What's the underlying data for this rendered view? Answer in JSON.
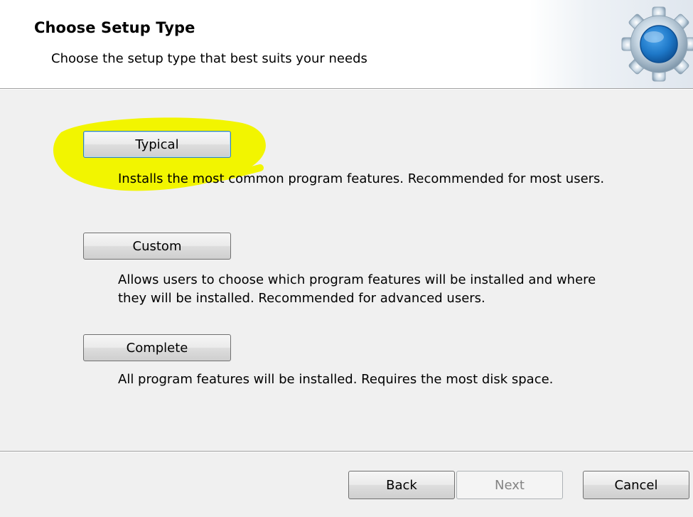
{
  "header": {
    "title": "Choose Setup Type",
    "subtitle": "Choose the setup type that best suits your needs",
    "icon": "gear-icon"
  },
  "options": [
    {
      "id": "typical",
      "label": "Typical",
      "description_lines": [
        "Installs the most common program features. Recommended for most users."
      ],
      "is_default": true
    },
    {
      "id": "custom",
      "label": "Custom",
      "description_lines": [
        "Allows users to choose which program features will be installed and where",
        "they will be installed. Recommended for advanced users."
      ],
      "is_default": false
    },
    {
      "id": "complete",
      "label": "Complete",
      "description_lines": [
        "All program features will be installed. Requires the most disk space."
      ],
      "is_default": false
    }
  ],
  "footer": {
    "back_label": "Back",
    "next_label": "Next",
    "next_enabled": false,
    "cancel_label": "Cancel"
  },
  "colors": {
    "highlight": "#f2f500",
    "dialog_background": "#f0f0f0",
    "header_background": "#ffffff",
    "default_button_border": "#3c7fb1"
  }
}
